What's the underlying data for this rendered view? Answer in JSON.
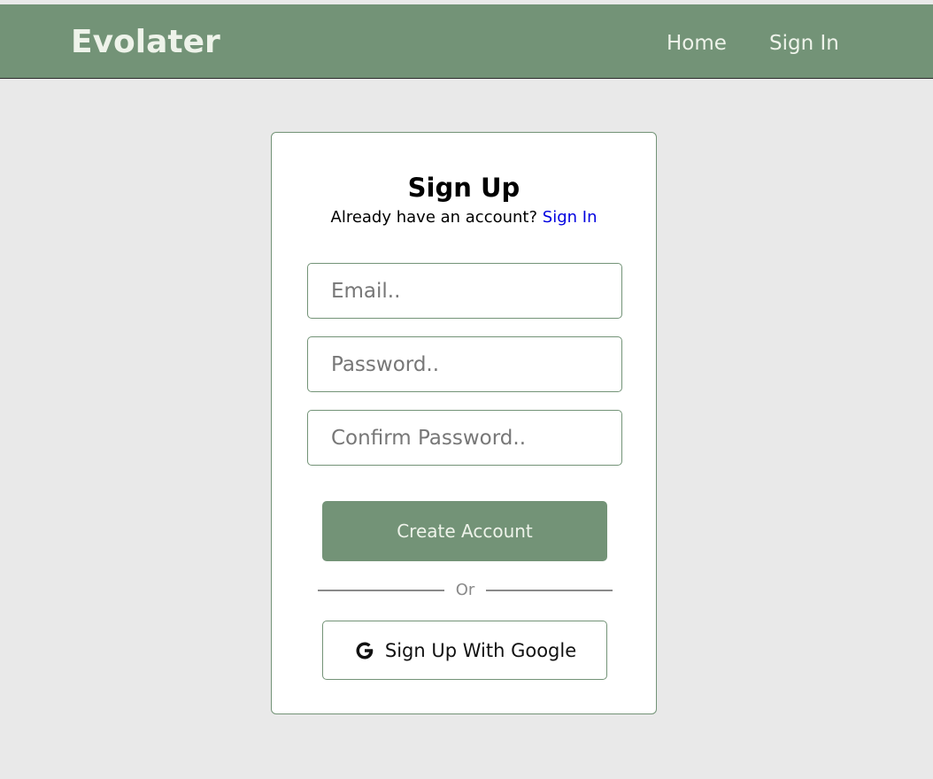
{
  "navbar": {
    "brand": "Evolater",
    "links": [
      {
        "label": "Home"
      },
      {
        "label": "Sign In"
      }
    ]
  },
  "signup": {
    "title": "Sign Up",
    "subtitle": "Already have an account?",
    "signin_link": "Sign In",
    "fields": {
      "email": {
        "placeholder": "Email..",
        "value": ""
      },
      "password": {
        "placeholder": "Password..",
        "value": ""
      },
      "confirm": {
        "placeholder": "Confirm Password..",
        "value": ""
      }
    },
    "create_button": "Create Account",
    "divider_text": "Or",
    "google_button": "Sign Up With Google",
    "google_icon": "google-g-icon"
  },
  "colors": {
    "brand_green": "#739377",
    "background": "#e9e9e9",
    "link_blue": "#0000e0"
  }
}
